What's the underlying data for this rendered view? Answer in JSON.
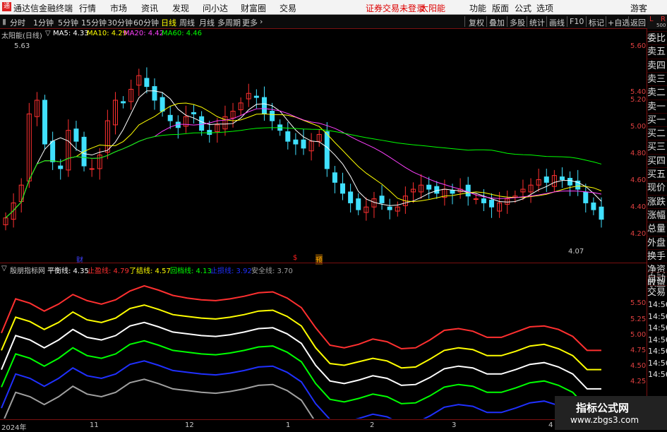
{
  "titlebar": {
    "app_name": "通达信金融终端",
    "menu": [
      "行情",
      "市场",
      "资讯",
      "发现",
      "问小达",
      "财富圈",
      "交易"
    ],
    "status": "证券交易未登录",
    "stock_short": "太阳能",
    "right_menu": [
      "功能",
      "版面",
      "公式",
      "选项"
    ],
    "guest": "游客"
  },
  "toolbar": {
    "periods": [
      "分时",
      "1分钟",
      "5分钟",
      "15分钟",
      "30分钟",
      "60分钟",
      "日线",
      "周线",
      "月线",
      "多周期",
      "更多"
    ],
    "active_period": "日线",
    "tools": [
      "复权",
      "叠加",
      "多股",
      "统计",
      "画线",
      "F10",
      "标记",
      "+自选",
      "返回"
    ]
  },
  "right_panel": {
    "corner_l": "L",
    "corner_r": "R",
    "corner_num": "500",
    "items": [
      "委比",
      "卖五",
      "卖四",
      "卖三",
      "卖二",
      "卖一",
      "买一",
      "买二",
      "买三",
      "买四",
      "买五",
      "现价",
      "涨跌",
      "涨幅",
      "总量",
      "外盘",
      "换手",
      "净资",
      "收益",
      "自动",
      "交易"
    ],
    "times": [
      "14:56",
      "14:56",
      "14:56",
      "14:56",
      "14:56",
      "14:56",
      "14:56"
    ]
  },
  "main_chart": {
    "title": "太阳能(日线)",
    "ma": [
      {
        "label": "MA5: 4.33",
        "color": "#ffffff"
      },
      {
        "label": "MA10: 4.29",
        "color": "#ffff00"
      },
      {
        "label": "MA20: 4.42",
        "color": "#ff40ff"
      },
      {
        "label": "MA60: 4.46",
        "color": "#00ff00"
      }
    ],
    "y_ticks": [
      "5.60",
      "5.40",
      "5.20",
      "5.00",
      "4.80",
      "4.60",
      "4.40",
      "4.20"
    ],
    "high_label": "5.63",
    "low_label": "4.07",
    "markers": [
      {
        "text": "财",
        "color": "#4040ff"
      },
      {
        "text": "$",
        "color": "#ff2020"
      },
      {
        "text": "预",
        "color": "#ffaa00"
      }
    ]
  },
  "sub_chart": {
    "title": "殷朋指标网",
    "indicators": [
      {
        "label": "平衡线: 4.35",
        "color": "#ffffff"
      },
      {
        "label": "止盈线: 4.79",
        "color": "#ff3030"
      },
      {
        "label": "了结线: 4.57",
        "color": "#ffff00"
      },
      {
        "label": "回档线: 4.13",
        "color": "#00ff00"
      },
      {
        "label": "止损线: 3.92",
        "color": "#2030ff"
      },
      {
        "label": "安全线: 3.70",
        "color": "#a0a0a0"
      }
    ],
    "y_ticks": [
      "5.50",
      "5.25",
      "5.00",
      "4.75",
      "4.50",
      "4.25"
    ]
  },
  "x_axis": [
    "2024年",
    "11",
    "12",
    "1",
    "2",
    "3",
    "4"
  ],
  "watermark": {
    "line1": "指标公式网",
    "line2": "www.zbgs3.com"
  },
  "chart_data": [
    {
      "type": "candlestick",
      "title": "太阳能(日线)",
      "ylim": [
        4.05,
        5.7
      ],
      "y_ticks": [
        4.2,
        4.4,
        4.6,
        4.8,
        5.0,
        5.2,
        5.4,
        5.6
      ],
      "high": 5.63,
      "low": 4.07,
      "close_series": [
        4.34,
        4.45,
        4.58,
        5.1,
        5.2,
        4.88,
        4.75,
        4.7,
        4.98,
        4.9,
        4.72,
        4.7,
        4.8,
        5.05,
        5.2,
        5.18,
        5.28,
        5.38,
        5.3,
        5.2,
        5.12,
        5.05,
        5.0,
        5.08,
        5.1,
        4.98,
        4.95,
        5.02,
        5.08,
        5.12,
        5.18,
        5.25,
        5.22,
        5.1,
        5.05,
        4.98,
        4.9,
        4.88,
        4.85,
        4.9,
        4.95,
        4.7,
        4.6,
        4.52,
        4.45,
        4.4,
        4.42,
        4.48,
        4.45,
        4.4,
        4.42,
        4.5,
        4.55,
        4.58,
        4.55,
        4.52,
        4.55,
        4.52,
        4.55,
        4.5,
        4.48,
        4.45,
        4.42,
        4.45,
        4.48,
        4.5,
        4.55,
        4.58,
        4.62,
        4.6,
        4.65,
        4.62,
        4.58,
        4.55,
        4.45,
        4.4,
        4.33
      ]
    },
    {
      "type": "line",
      "title": "殷朋指标网",
      "ylim": [
        4.05,
        5.65
      ],
      "series": [
        {
          "name": "止盈线",
          "color": "#ff3030",
          "values": [
            4.99,
            5.38,
            5.33,
            5.24,
            5.32,
            5.43,
            5.36,
            5.32,
            5.37,
            5.47,
            5.53,
            5.48,
            5.42,
            5.39,
            5.37,
            5.36,
            5.38,
            5.41,
            5.45,
            5.46,
            5.39,
            5.28,
            5.05,
            4.85,
            4.82,
            4.86,
            4.92,
            4.89,
            4.81,
            4.82,
            4.91,
            5.02,
            5.04,
            5.01,
            4.94,
            4.94,
            5.0,
            5.06,
            5.07,
            5.03,
            4.95,
            4.79,
            4.79
          ]
        },
        {
          "name": "了结线",
          "color": "#ffff00",
          "values": [
            4.79,
            5.17,
            5.12,
            5.03,
            5.11,
            5.23,
            5.14,
            5.11,
            5.16,
            5.27,
            5.31,
            5.26,
            5.2,
            5.18,
            5.16,
            5.15,
            5.17,
            5.2,
            5.24,
            5.25,
            5.18,
            5.07,
            4.82,
            4.64,
            4.62,
            4.66,
            4.7,
            4.67,
            4.59,
            4.6,
            4.69,
            4.79,
            4.82,
            4.8,
            4.73,
            4.73,
            4.78,
            4.84,
            4.86,
            4.81,
            4.73,
            4.57,
            4.57
          ]
        },
        {
          "name": "平衡线",
          "color": "#ffffff",
          "values": [
            4.57,
            4.96,
            4.91,
            4.82,
            4.91,
            5.03,
            4.94,
            4.91,
            4.96,
            5.07,
            5.11,
            5.06,
            5.0,
            4.98,
            4.96,
            4.95,
            4.97,
            5.0,
            5.04,
            5.05,
            4.98,
            4.87,
            4.62,
            4.44,
            4.41,
            4.45,
            4.5,
            4.47,
            4.39,
            4.4,
            4.48,
            4.58,
            4.61,
            4.59,
            4.52,
            4.52,
            4.57,
            4.63,
            4.65,
            4.6,
            4.52,
            4.35,
            4.35
          ]
        },
        {
          "name": "回档线",
          "color": "#00ff00",
          "values": [
            4.37,
            4.75,
            4.7,
            4.61,
            4.7,
            4.82,
            4.73,
            4.7,
            4.75,
            4.86,
            4.9,
            4.85,
            4.79,
            4.77,
            4.75,
            4.74,
            4.76,
            4.79,
            4.83,
            4.84,
            4.77,
            4.66,
            4.41,
            4.23,
            4.2,
            4.24,
            4.29,
            4.26,
            4.18,
            4.19,
            4.27,
            4.37,
            4.4,
            4.38,
            4.31,
            4.31,
            4.36,
            4.42,
            4.44,
            4.39,
            4.31,
            4.13,
            4.13
          ]
        },
        {
          "name": "止损线",
          "color": "#2030ff",
          "values": [
            4.13,
            4.52,
            4.47,
            4.38,
            4.47,
            4.59,
            4.5,
            4.47,
            4.52,
            4.63,
            4.67,
            4.62,
            4.56,
            4.54,
            4.52,
            4.51,
            4.53,
            4.56,
            4.6,
            4.61,
            4.54,
            4.43,
            4.18,
            4.0,
            3.97,
            4.01,
            4.06,
            4.03,
            3.95,
            3.96,
            4.04,
            4.14,
            4.17,
            4.15,
            4.08,
            4.08,
            4.13,
            4.19,
            4.21,
            4.16,
            4.08,
            3.92,
            3.92
          ]
        },
        {
          "name": "安全线",
          "color": "#a0a0a0",
          "values": [
            3.93,
            4.31,
            4.26,
            4.17,
            4.26,
            4.38,
            4.29,
            4.26,
            4.31,
            4.42,
            4.46,
            4.41,
            4.35,
            4.33,
            4.31,
            4.3,
            4.32,
            4.35,
            4.39,
            4.4,
            4.33,
            4.22,
            3.97,
            3.79,
            3.76,
            3.8,
            3.85,
            3.82,
            3.74,
            3.75,
            3.83,
            3.93,
            3.96,
            3.94,
            3.87,
            3.87,
            3.92,
            3.98,
            4.0,
            3.95,
            3.87,
            3.7,
            3.7
          ]
        }
      ]
    }
  ]
}
